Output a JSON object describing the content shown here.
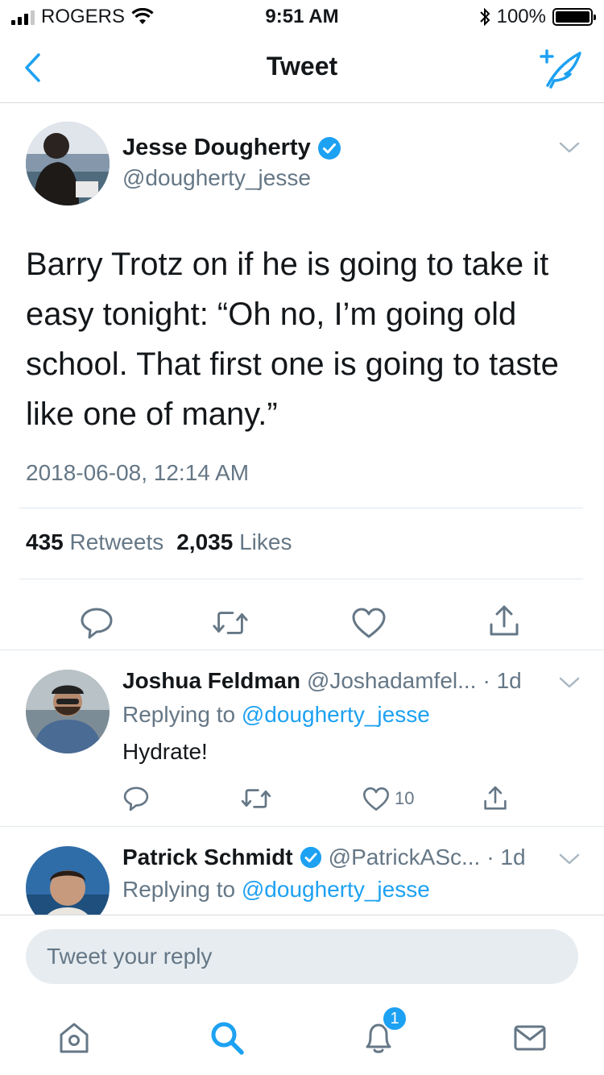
{
  "status_bar": {
    "carrier": "ROGERS",
    "time": "9:51 AM",
    "battery": "100%"
  },
  "nav": {
    "title": "Tweet",
    "back_icon": "chevron-left-icon",
    "compose_icon": "compose-tweet-icon"
  },
  "tweet": {
    "author_name": "Jesse Dougherty",
    "author_handle": "@dougherty_jesse",
    "verified": true,
    "text": "Barry Trotz on if he is going to take it easy tonight: “Oh no, I’m going old school. That first one is going to taste like one of many.”",
    "timestamp": "2018-06-08, 12:14 AM",
    "retweets_count": "435",
    "retweets_label": "Retweets",
    "likes_count": "2,035",
    "likes_label": "Likes"
  },
  "replies": [
    {
      "name": "Joshua Feldman",
      "handle": "@Joshadamfel...",
      "time": "· 1d",
      "replying_prefix": "Replying to",
      "replying_to": "@dougherty_jesse",
      "text": "Hydrate!",
      "like_count": "10",
      "verified": false
    },
    {
      "name": "Patrick Schmidt",
      "handle": "@PatrickASc...",
      "time": "· 1d",
      "replying_prefix": "Replying to",
      "replying_to": "@dougherty_jesse",
      "verified": true
    }
  ],
  "reply_box": {
    "placeholder": "Tweet your reply"
  },
  "tab_bar": {
    "notifications_badge": "1"
  },
  "colors": {
    "accent": "#1da1f2",
    "secondary_text": "#657786",
    "primary_text": "#14171a"
  }
}
